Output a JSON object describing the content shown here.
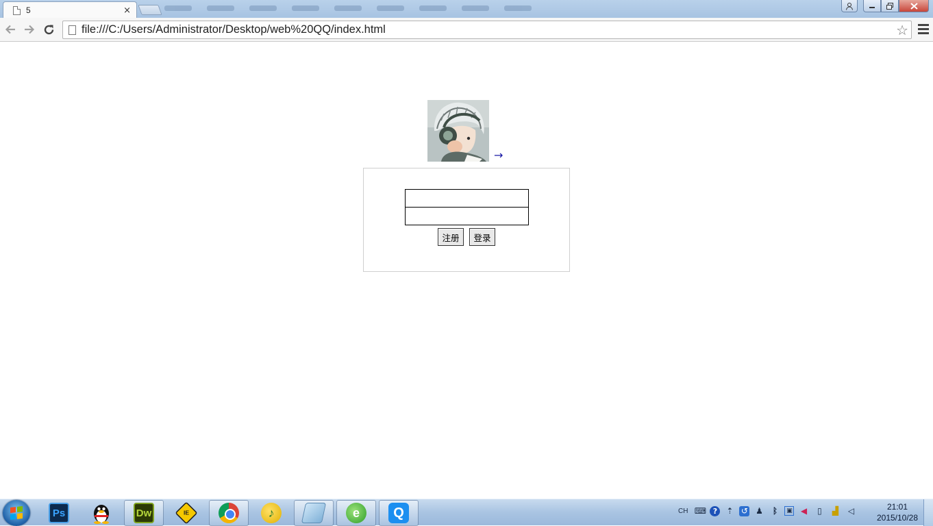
{
  "browser": {
    "tab_title": "5",
    "tab_close": "×",
    "url": "file:///C:/Users/Administrator/Desktop/web%20QQ/index.html",
    "icons": {
      "back": "arrow-left-icon",
      "forward": "arrow-right-icon",
      "reload": "reload-icon",
      "bookmark": "star-icon",
      "menu": "hamburger-menu-icon"
    }
  },
  "page": {
    "avatar": "avatar-image",
    "arrow_link": "→",
    "login": {
      "username_value": "",
      "password_value": "",
      "register_label": "注册",
      "login_label": "登录"
    }
  },
  "taskbar": {
    "apps": [
      {
        "name": "photoshop",
        "label": "Ps"
      },
      {
        "name": "qq",
        "label": ""
      },
      {
        "name": "dreamweaver",
        "label": "Dw"
      },
      {
        "name": "ie-tester",
        "label": "IE"
      },
      {
        "name": "chrome",
        "label": ""
      },
      {
        "name": "qq-music",
        "label": "♪"
      },
      {
        "name": "window",
        "label": ""
      },
      {
        "name": "ie-browser",
        "label": "e"
      },
      {
        "name": "qq-browser",
        "label": "Q"
      }
    ],
    "tray": {
      "ime": "CH",
      "icons": [
        "keyboard-icon",
        "help-icon",
        "expand-tray-icon",
        "app-icon",
        "qq-tray-icon",
        "bluetooth-icon",
        "network-icon",
        "volume-icon",
        "device-icon",
        "signal-icon",
        "speaker-icon"
      ]
    },
    "clock": {
      "time": "21:01",
      "date": "2015/10/28"
    }
  },
  "colors": {
    "taskbar": "#a9c4e2",
    "title_bar": "#b9d1ea",
    "login_border": "#cfcfcf",
    "arrow_link": "#1a1aa6"
  }
}
